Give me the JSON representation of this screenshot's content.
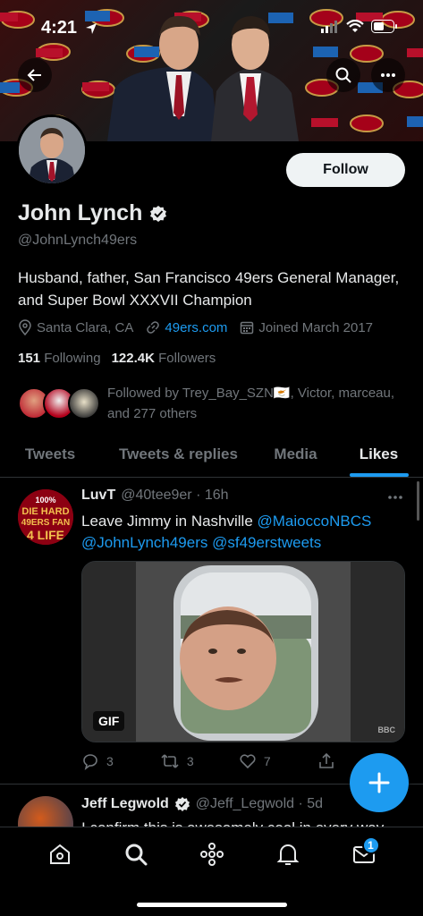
{
  "status_bar": {
    "time": "4:21"
  },
  "profile": {
    "name": "John Lynch",
    "handle": "@JohnLynch49ers",
    "bio": "Husband, father, San Francisco 49ers General Manager, and Super Bowl XXXVII Champion",
    "location": "Santa Clara, CA",
    "website": "49ers.com",
    "joined": "Joined March 2017",
    "following_count": "151",
    "following_label": "Following",
    "followers_count": "122.4K",
    "followers_label": "Followers",
    "followed_by": "Followed by Trey_Bay_SZN🇨🇾, Victor, marceau, and 277 others",
    "follow_button": "Follow"
  },
  "tabs": [
    {
      "label": "Tweets",
      "active": false
    },
    {
      "label": "Tweets & replies",
      "active": false
    },
    {
      "label": "Media",
      "active": false
    },
    {
      "label": "Likes",
      "active": true
    }
  ],
  "tweet1": {
    "display_name": "LuvT",
    "handle_time": "@40tee9er · 16h",
    "text_plain": "Leave Jimmy in Nashville ",
    "mention1": "@MaioccoNBCS",
    "mention2": "@JohnLynch49ers",
    "mention3": "@sf49erstweets",
    "media_badge": "GIF",
    "media_watermark": "BBC",
    "avatar_text": "100% DIE HARD 49ERS FAN 4 LIFE",
    "replies": "3",
    "retweets": "3",
    "likes": "7"
  },
  "tweet2": {
    "display_name": "Jeff Legwold",
    "handle_time": "@Jeff_Legwold · 5d",
    "text_partial": "I confirm this is awesomely cool in every way"
  },
  "nav": {
    "messages_badge": "1"
  },
  "colors": {
    "accent": "#1d9bf0",
    "background": "#000000",
    "secondary_text": "#71767b"
  }
}
